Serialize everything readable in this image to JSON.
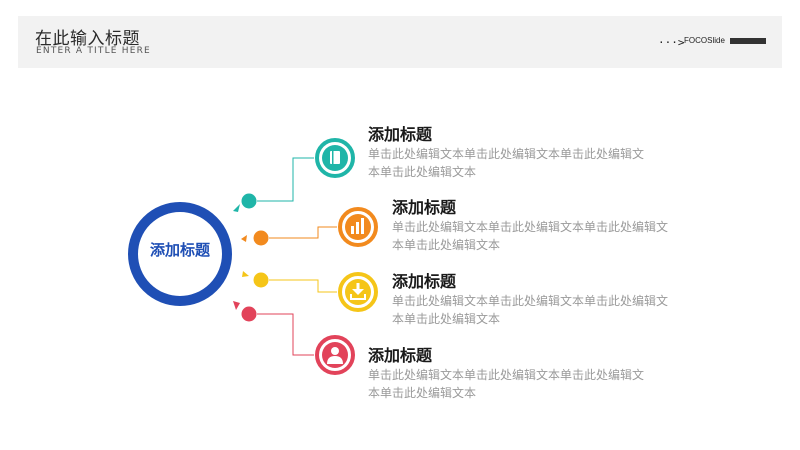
{
  "header": {
    "title": "在此输入标题",
    "subtitle": "ENTER A TITLE HERE",
    "brand_arrow": "···>",
    "brand": "FOCOSlide"
  },
  "center": {
    "label": "添加标题"
  },
  "items": [
    {
      "title": "添加标题",
      "line1": "单击此处编辑文本单击此处编辑文本单击此处编辑文",
      "line2": "本单击此处编辑文本",
      "color": "#1fb5a8",
      "icon": "book-icon"
    },
    {
      "title": "添加标题",
      "line1": "单击此处编辑文本单击此处编辑文本单击此处编辑文",
      "line2": "本单击此处编辑文本",
      "color": "#f28a1e",
      "icon": "bar-chart-icon"
    },
    {
      "title": "添加标题",
      "line1": "单击此处编辑文本单击此处编辑文本单击此处编辑文",
      "line2": "本单击此处编辑文本",
      "color": "#f5c518",
      "icon": "download-icon"
    },
    {
      "title": "添加标题",
      "line1": "单击此处编辑文本单击此处编辑文本单击此处编辑文",
      "line2": "本单击此处编辑文本",
      "color": "#e2435a",
      "icon": "user-icon"
    }
  ],
  "colors": {
    "center": "#1f4fb5"
  }
}
